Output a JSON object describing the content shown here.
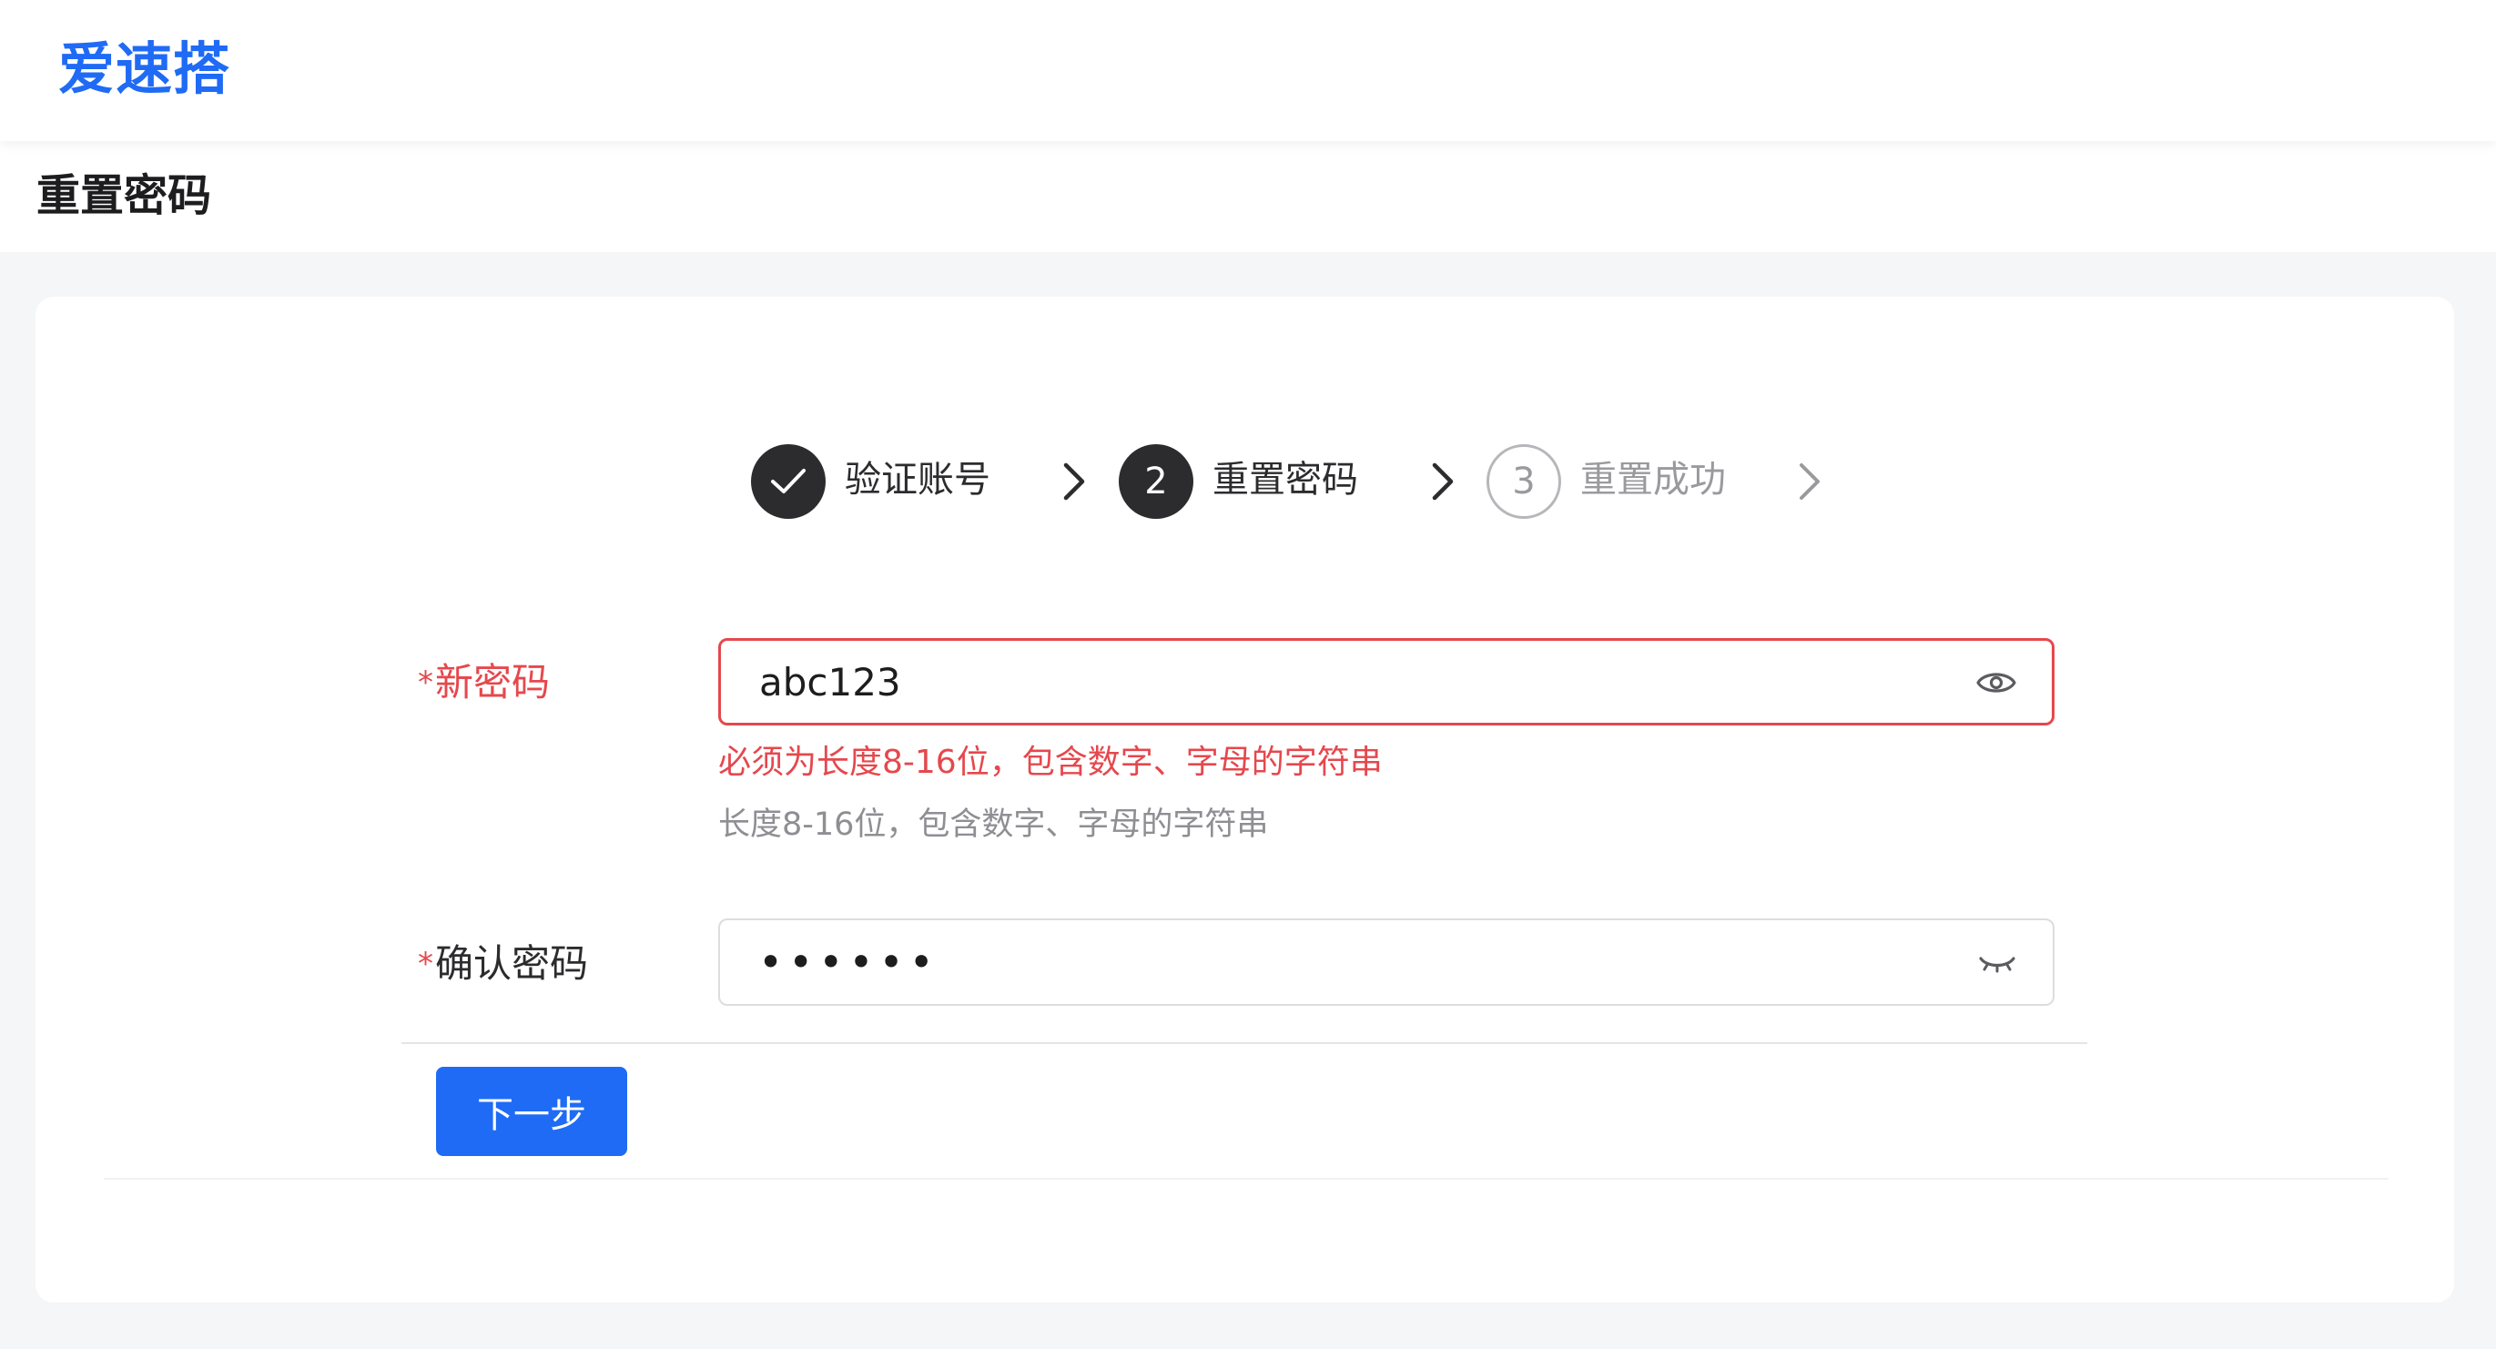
{
  "header": {
    "logo_text": "爱速搭"
  },
  "page": {
    "title": "重置密码"
  },
  "steps": [
    {
      "number": "",
      "label": "验证账号",
      "status": "done"
    },
    {
      "number": "2",
      "label": "重置密码",
      "status": "active"
    },
    {
      "number": "3",
      "label": "重置成功",
      "status": "pending"
    }
  ],
  "form": {
    "new_password": {
      "required_mark": "*",
      "label": "新密码",
      "value": "abc123",
      "error": "必须为长度8-16位，包含数字、字母的字符串",
      "hint": "长度8-16位，包含数字、字母的字符串"
    },
    "confirm_password": {
      "required_mark": "*",
      "label": "确认密码",
      "value": "••••••"
    },
    "next_label": "下一步"
  },
  "colors": {
    "brand": "#1f6bf5",
    "error": "#e5484d",
    "step_active": "#2c2c2e",
    "step_pending": "#9a9a9e"
  },
  "icons": {
    "step1": "check-icon",
    "separator": "chevron-right-icon",
    "show_password": "eye-icon",
    "hidden_password": "eye-closed-icon"
  }
}
